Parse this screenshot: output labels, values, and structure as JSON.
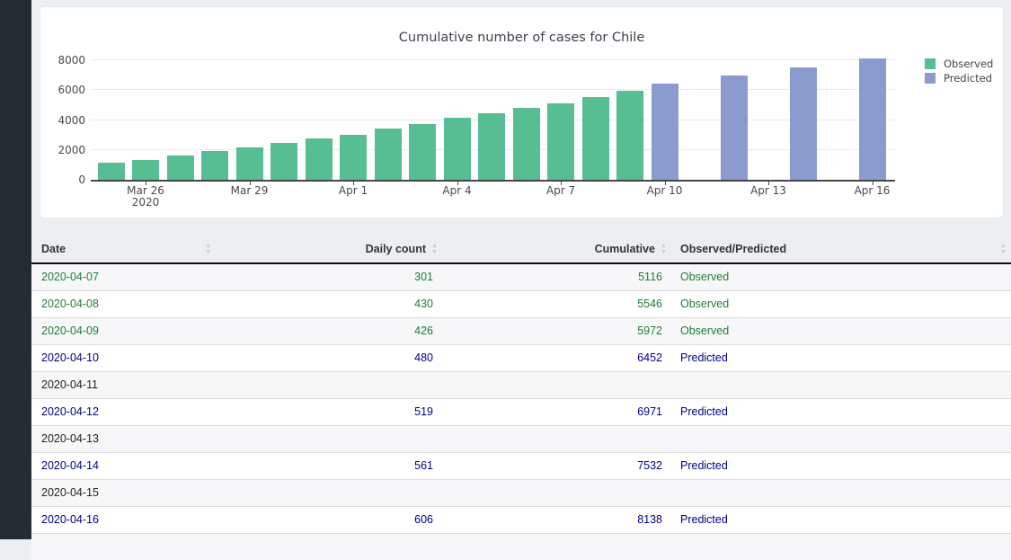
{
  "chart_data": {
    "type": "bar",
    "title": "Cumulative number of cases for Chile",
    "xlabel": "",
    "ylabel": "",
    "grid": true,
    "legend_position": "top-right",
    "y_ticks": [
      0,
      2000,
      4000,
      6000,
      8000
    ],
    "ylim": [
      0,
      8480
    ],
    "x": [
      "2020-03-25",
      "2020-03-26",
      "2020-03-27",
      "2020-03-28",
      "2020-03-29",
      "2020-03-30",
      "2020-03-31",
      "2020-04-01",
      "2020-04-02",
      "2020-04-03",
      "2020-04-04",
      "2020-04-05",
      "2020-04-06",
      "2020-04-07",
      "2020-04-08",
      "2020-04-09",
      "2020-04-10",
      "2020-04-11",
      "2020-04-12",
      "2020-04-13",
      "2020-04-14",
      "2020-04-15",
      "2020-04-16"
    ],
    "x_ticks": [
      {
        "index": 1,
        "label": "Mar 26",
        "sublabel": "2020"
      },
      {
        "index": 4,
        "label": "Mar 29"
      },
      {
        "index": 7,
        "label": "Apr 1"
      },
      {
        "index": 10,
        "label": "Apr 4"
      },
      {
        "index": 13,
        "label": "Apr 7"
      },
      {
        "index": 16,
        "label": "Apr 10"
      },
      {
        "index": 19,
        "label": "Apr 13"
      },
      {
        "index": 22,
        "label": "Apr 16"
      }
    ],
    "series": [
      {
        "name": "Observed",
        "color": "#57bd93",
        "values": [
          1142,
          1306,
          1610,
          1909,
          2139,
          2449,
          2738,
          3031,
          3404,
          3737,
          4161,
          4471,
          4815,
          5116,
          5546,
          5972,
          null,
          null,
          null,
          null,
          null,
          null,
          null
        ]
      },
      {
        "name": "Predicted",
        "color": "#8c9bcd",
        "values": [
          null,
          null,
          null,
          null,
          null,
          null,
          null,
          null,
          null,
          null,
          null,
          null,
          null,
          null,
          null,
          null,
          6452,
          null,
          6971,
          null,
          7532,
          null,
          8138
        ]
      }
    ]
  },
  "table": {
    "columns": [
      {
        "label": "Date",
        "align": "left"
      },
      {
        "label": "Daily count",
        "align": "right"
      },
      {
        "label": "Cumulative",
        "align": "right"
      },
      {
        "label": "Observed/Predicted",
        "align": "left"
      }
    ],
    "rows": [
      {
        "date": "2020-04-07",
        "daily": "301",
        "cumulative": "5116",
        "status": "Observed"
      },
      {
        "date": "2020-04-08",
        "daily": "430",
        "cumulative": "5546",
        "status": "Observed"
      },
      {
        "date": "2020-04-09",
        "daily": "426",
        "cumulative": "5972",
        "status": "Observed"
      },
      {
        "date": "2020-04-10",
        "daily": "480",
        "cumulative": "6452",
        "status": "Predicted"
      },
      {
        "date": "2020-04-11",
        "daily": "",
        "cumulative": "",
        "status": ""
      },
      {
        "date": "2020-04-12",
        "daily": "519",
        "cumulative": "6971",
        "status": "Predicted"
      },
      {
        "date": "2020-04-13",
        "daily": "",
        "cumulative": "",
        "status": ""
      },
      {
        "date": "2020-04-14",
        "daily": "561",
        "cumulative": "7532",
        "status": "Predicted"
      },
      {
        "date": "2020-04-15",
        "daily": "",
        "cumulative": "",
        "status": ""
      },
      {
        "date": "2020-04-16",
        "daily": "606",
        "cumulative": "8138",
        "status": "Predicted"
      }
    ],
    "status_colors": {
      "Observed": "#1e7e34",
      "Predicted": "#00008b",
      "": "#222222"
    },
    "sort_icon_up": "▲",
    "sort_icon_down": "▼"
  }
}
